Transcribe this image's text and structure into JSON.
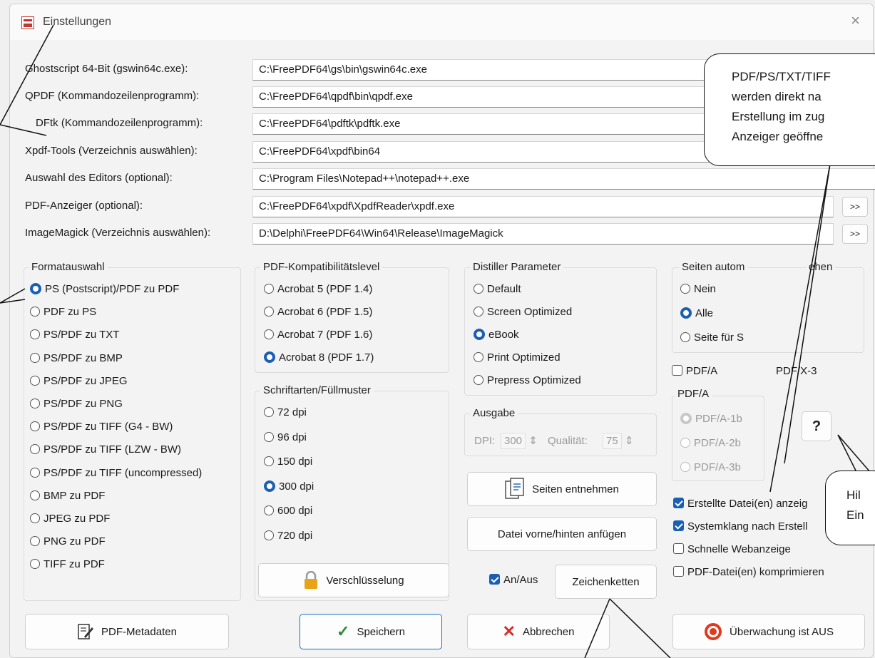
{
  "window": {
    "title": "Einstellungen",
    "close": "×"
  },
  "paths": [
    {
      "label": "Ghostscript 64-Bit (gswin64c.exe):",
      "value": "C:\\FreePDF64\\gs\\bin\\gswin64c.exe"
    },
    {
      "label": "QPDF (Kommandozeilenprogramm):",
      "value": "C:\\FreePDF64\\qpdf\\bin\\qpdf.exe"
    },
    {
      "label": "DFtk (Kommandozeilenprogramm):",
      "value": "C:\\FreePDF64\\pdftk\\pdftk.exe"
    },
    {
      "label": "Xpdf-Tools (Verzeichnis auswählen):",
      "value": "C:\\FreePDF64\\xpdf\\bin64"
    },
    {
      "label": "Auswahl des Editors (optional):",
      "value": "C:\\Program Files\\Notepad++\\notepad++.exe"
    },
    {
      "label": "PDF-Anzeiger (optional):",
      "value": "C:\\FreePDF64\\xpdf\\XpdfReader\\xpdf.exe"
    },
    {
      "label": "ImageMagick (Verzeichnis auswählen):",
      "value": "D:\\Delphi\\FreePDF64\\Win64\\Release\\ImageMagick"
    }
  ],
  "browse_label": ">>",
  "format": {
    "title": "Formatauswahl",
    "options": [
      "PS (Postscript)/PDF zu PDF",
      "PDF zu PS",
      "PS/PDF zu TXT",
      "PS/PDF zu BMP",
      "PS/PDF zu JPEG",
      "PS/PDF zu PNG",
      "PS/PDF zu TIFF (G4 - BW)",
      "PS/PDF zu TIFF (LZW - BW)",
      "PS/PDF zu TIFF (uncompressed)",
      "BMP zu PDF",
      "JPEG zu PDF",
      "PNG zu PDF",
      "TIFF zu PDF"
    ],
    "selected": 0
  },
  "compat": {
    "title": "PDF-Kompatibilitätslevel",
    "options": [
      "Acrobat 5 (PDF 1.4)",
      "Acrobat 6 (PDF 1.5)",
      "Acrobat 7 (PDF 1.6)",
      "Acrobat 8 (PDF 1.7)"
    ],
    "selected": 3
  },
  "fonts": {
    "title": "Schriftarten/Füllmuster",
    "options": [
      "72 dpi",
      "96 dpi",
      "150 dpi",
      "300 dpi",
      "600 dpi",
      "720 dpi"
    ],
    "selected": 3
  },
  "distiller": {
    "title": "Distiller Parameter",
    "options": [
      "Default",
      "Screen Optimized",
      "eBook",
      "Print Optimized",
      "Prepress Optimized"
    ],
    "selected": 2
  },
  "output": {
    "title": "Ausgabe",
    "dpi_label": "DPI:",
    "dpi": "300",
    "quality_label": "Qualität:",
    "quality": "75"
  },
  "rotate": {
    "title_left": "Seiten autom",
    "title_right": "ehen",
    "options": [
      "Nein",
      "Alle",
      "Seite für S"
    ],
    "selected": 1
  },
  "pdfa_checkbox": "PDF/A",
  "pdfx_label": "PDF/X-3",
  "pdfa": {
    "title": "PDF/A",
    "options": [
      "PDF/A-1b",
      "PDF/A-2b",
      "PDF/A-3b"
    ]
  },
  "help_button": "?",
  "checks": [
    {
      "label": "Erstellte Datei(en) anzeig",
      "checked": true
    },
    {
      "label": "Systemklang nach Erstell",
      "checked": true
    },
    {
      "label": "Schnelle Webanzeige",
      "checked": false
    },
    {
      "label": "PDF-Datei(en) komprimieren",
      "checked": false
    }
  ],
  "buttons": {
    "extract": "Seiten entnehmen",
    "append": "Datei vorne/hinten anfügen",
    "encrypt": "Verschlüsselung",
    "onoff": "An/Aus",
    "strings": "Zeichenketten",
    "metadata": "PDF-Metadaten",
    "save": "Speichern",
    "cancel": "Abbrechen",
    "monitor": "Überwachung ist AUS"
  },
  "callouts": {
    "top": [
      "PDF/PS/TXT/TIFF",
      "werden direkt na",
      "Erstellung im zug",
      "Anzeiger geöffne"
    ],
    "help": [
      "Hil",
      "Ein"
    ]
  },
  "colors": {
    "accent": "#1a5fb4",
    "save_border": "#1a6fc4",
    "cancel_x": "#d62b2b",
    "save_check": "#2e8b3a",
    "lock": "#e8a317",
    "monitor_red": "#e03a1e"
  }
}
